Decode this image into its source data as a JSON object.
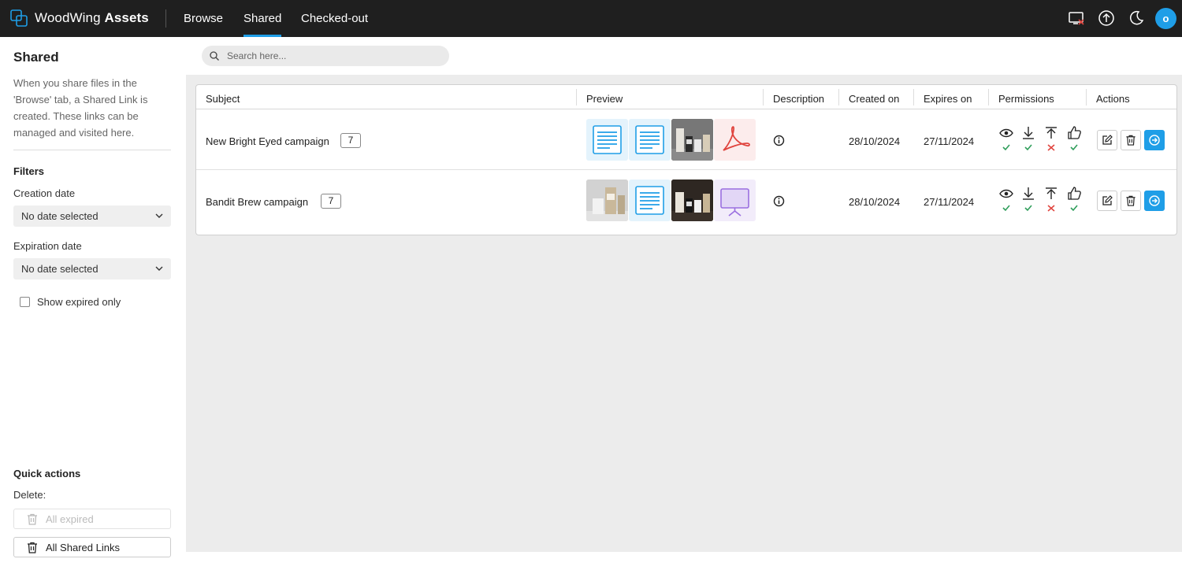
{
  "app": {
    "brand_part1": "WoodWing",
    "brand_part2": "Assets",
    "nav": [
      {
        "label": "Browse",
        "active": false
      },
      {
        "label": "Shared",
        "active": true
      },
      {
        "label": "Checked-out",
        "active": false
      }
    ],
    "top_icons": [
      "screen-error-icon",
      "upload-icon",
      "moon-icon"
    ],
    "avatar_initial": "o",
    "accent_color": "#1f9ee7"
  },
  "sidebar": {
    "title": "Shared",
    "description": "When you share files in the 'Browse' tab, a Shared Link is created. These links can be managed and visited here.",
    "filters_heading": "Filters",
    "creation_date_label": "Creation date",
    "creation_date_value": "No date selected",
    "expiration_date_label": "Expiration date",
    "expiration_date_value": "No date selected",
    "show_expired_label": "Show expired only",
    "quick_actions_heading": "Quick actions",
    "delete_label": "Delete:",
    "all_expired_label": "All expired",
    "all_shared_links_label": "All Shared Links"
  },
  "search": {
    "placeholder": "Search here..."
  },
  "table": {
    "headers": {
      "subject": "Subject",
      "preview": "Preview",
      "description": "Description",
      "created_on": "Created on",
      "expires_on": "Expires on",
      "permissions": "Permissions",
      "actions": "Actions"
    },
    "rows": [
      {
        "subject": "New Bright Eyed campaign",
        "count": "7",
        "previews": [
          "document",
          "document",
          "product-photo",
          "pdf"
        ],
        "created_on": "28/10/2024",
        "expires_on": "27/11/2024",
        "permissions": {
          "view": true,
          "download": true,
          "upload": false,
          "approve": true
        }
      },
      {
        "subject": "Bandit Brew campaign",
        "count": "7",
        "previews": [
          "product-photo",
          "document",
          "product-photo",
          "presentation"
        ],
        "created_on": "28/10/2024",
        "expires_on": "27/11/2024",
        "permissions": {
          "view": true,
          "download": true,
          "upload": false,
          "approve": true
        }
      }
    ],
    "status_colors": {
      "allowed": "#2f9e5b",
      "denied": "#e0443e"
    }
  }
}
